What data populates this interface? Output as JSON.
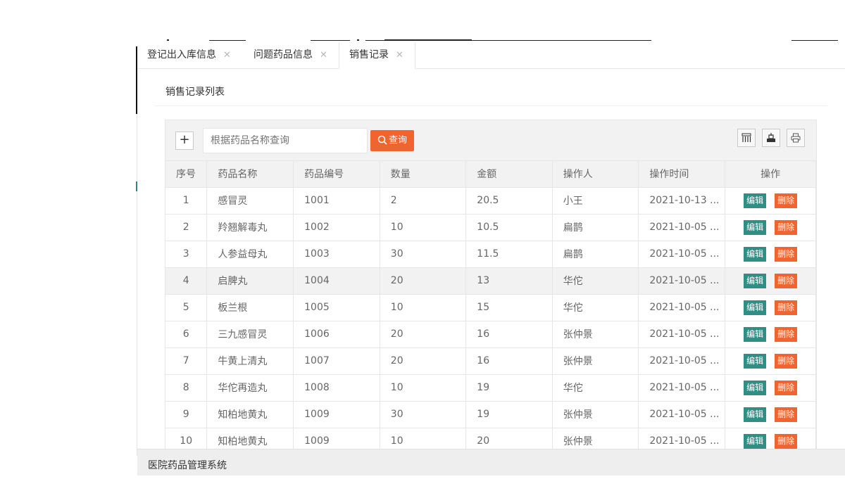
{
  "tabs": [
    {
      "label": "登记出入库信息",
      "active": false
    },
    {
      "label": "问题药品信息",
      "active": false
    },
    {
      "label": "销售记录",
      "active": true
    }
  ],
  "tab_close_glyph": "✕",
  "panel": {
    "title": "销售记录列表"
  },
  "toolbar": {
    "add_label": "+",
    "search_placeholder": "根据药品名称查询",
    "search_button": "查询",
    "icons": [
      "columns-icon",
      "export-icon",
      "print-icon"
    ]
  },
  "table": {
    "headers": [
      "序号",
      "药品名称",
      "药品编号",
      "数量",
      "金额",
      "操作人",
      "操作时间",
      "操作"
    ],
    "edit_label": "编辑",
    "delete_label": "删除",
    "rows": [
      [
        "1",
        "感冒灵",
        "1001",
        "2",
        "20.5",
        "小王",
        "2021-10-13 ..."
      ],
      [
        "2",
        "羚翘解毒丸",
        "1002",
        "10",
        "10.5",
        "扁鹊",
        "2021-10-05 ..."
      ],
      [
        "3",
        "人参益母丸",
        "1003",
        "30",
        "11.5",
        "扁鹊",
        "2021-10-05 ..."
      ],
      [
        "4",
        "启脾丸",
        "1004",
        "20",
        "13",
        "华佗",
        "2021-10-05 ..."
      ],
      [
        "5",
        "板兰根",
        "1005",
        "10",
        "15",
        "华佗",
        "2021-10-05 ..."
      ],
      [
        "6",
        "三九感冒灵",
        "1006",
        "20",
        "16",
        "张仲景",
        "2021-10-05 ..."
      ],
      [
        "7",
        "牛黄上清丸",
        "1007",
        "20",
        "16",
        "张仲景",
        "2021-10-05 ..."
      ],
      [
        "8",
        "华佗再造丸",
        "1008",
        "10",
        "19",
        "华佗",
        "2021-10-05 ..."
      ],
      [
        "9",
        "知柏地黄丸",
        "1009",
        "30",
        "19",
        "张仲景",
        "2021-10-05 ..."
      ],
      [
        "10",
        "知柏地黄丸",
        "1009",
        "10",
        "20",
        "张仲景",
        "2021-10-05 ..."
      ]
    ],
    "hover_row": 3
  },
  "footer": {
    "text": "医院药品管理系统"
  },
  "colors": {
    "primary": "#2f8f84",
    "danger": "#f0642f",
    "header_bg": "#f2f2f2"
  }
}
